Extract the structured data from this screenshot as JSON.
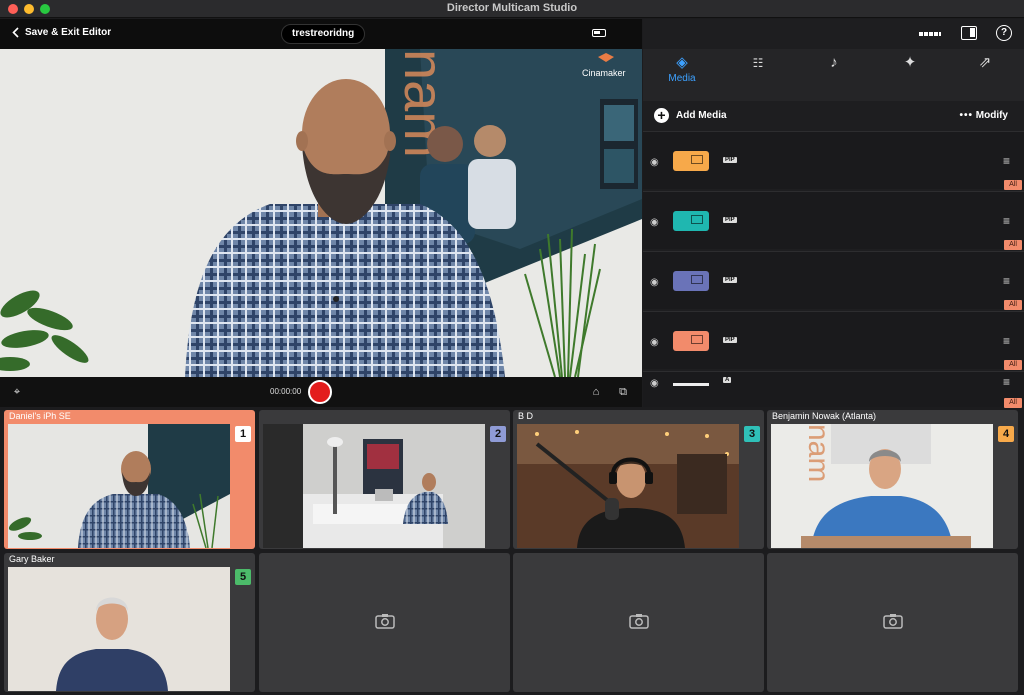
{
  "window": {
    "title": "Director Multicam Studio"
  },
  "preview": {
    "exit_label": "Save & Exit Editor",
    "project_name": "trestreoridng",
    "timecode": "00:00:00",
    "brand_text": "Cinamaker"
  },
  "right_panel": {
    "tabs": [
      {
        "label": "Media",
        "icon": "layers-icon",
        "active": true
      },
      {
        "label": "",
        "icon": "sliders-icon"
      },
      {
        "label": "",
        "icon": "music-note-icon"
      },
      {
        "label": "",
        "icon": "magic-wand-icon"
      },
      {
        "label": "",
        "icon": "share-icon"
      }
    ],
    "add_media_label": "Add Media",
    "modify_label": "Modify",
    "media_rows": [
      {
        "color": "#f7a94a",
        "tag": "PIP",
        "badge": "All"
      },
      {
        "color": "#1fb7b0",
        "tag": "PIP",
        "badge": "All"
      },
      {
        "color": "#6a73b8",
        "tag": "PIP",
        "badge": "All"
      },
      {
        "color": "#f28b6b",
        "tag": "PIP",
        "badge": "All"
      },
      {
        "color": "#eeeeee",
        "tag": "",
        "badge": "All"
      }
    ]
  },
  "cameras": [
    {
      "name": "Daniel's iPh SE",
      "number": "1",
      "number_color": "#ffffff",
      "active": true
    },
    {
      "name": "",
      "number": "2",
      "number_color": "#8f9bd6"
    },
    {
      "name": "B D",
      "number": "3",
      "number_color": "#2fc0b8"
    },
    {
      "name": "Benjamin Nowak (Atlanta)",
      "number": "4",
      "number_color": "#f7a94a"
    },
    {
      "name": "Gary Baker",
      "number": "5",
      "number_color": "#4cbb6a"
    },
    {
      "name": "",
      "number": ""
    },
    {
      "name": "",
      "number": ""
    },
    {
      "name": "",
      "number": ""
    }
  ]
}
